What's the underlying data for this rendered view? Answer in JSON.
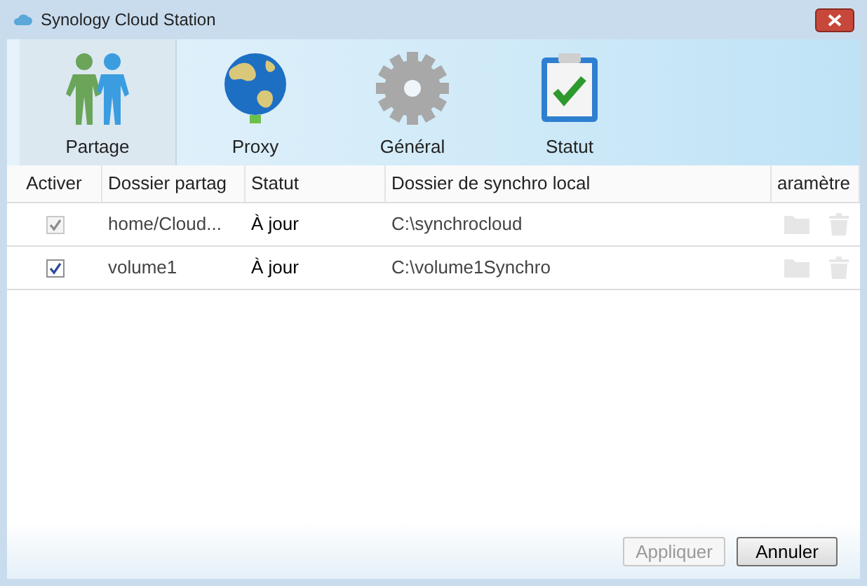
{
  "window": {
    "title": "Synology Cloud Station"
  },
  "tabs": [
    {
      "label": "Partage",
      "kind": "people",
      "selected": true
    },
    {
      "label": "Proxy",
      "kind": "globe",
      "selected": false
    },
    {
      "label": "Général",
      "kind": "gear",
      "selected": false
    },
    {
      "label": "Statut",
      "kind": "clipboard",
      "selected": false
    }
  ],
  "table": {
    "columns": [
      "Activer",
      "Dossier partag",
      "Statut",
      "Dossier de synchro local",
      "aramètre"
    ],
    "rows": [
      {
        "checked": true,
        "disabled": true,
        "shared_folder": "home/Cloud...",
        "status": "À jour",
        "local_folder": "C:\\synchrocloud"
      },
      {
        "checked": true,
        "disabled": false,
        "shared_folder": "volume1",
        "status": "À jour",
        "local_folder": "C:\\volume1Synchro"
      }
    ]
  },
  "buttons": [
    {
      "label": "Appliquer",
      "disabled": true
    },
    {
      "label": "Annuler",
      "disabled": false
    }
  ]
}
